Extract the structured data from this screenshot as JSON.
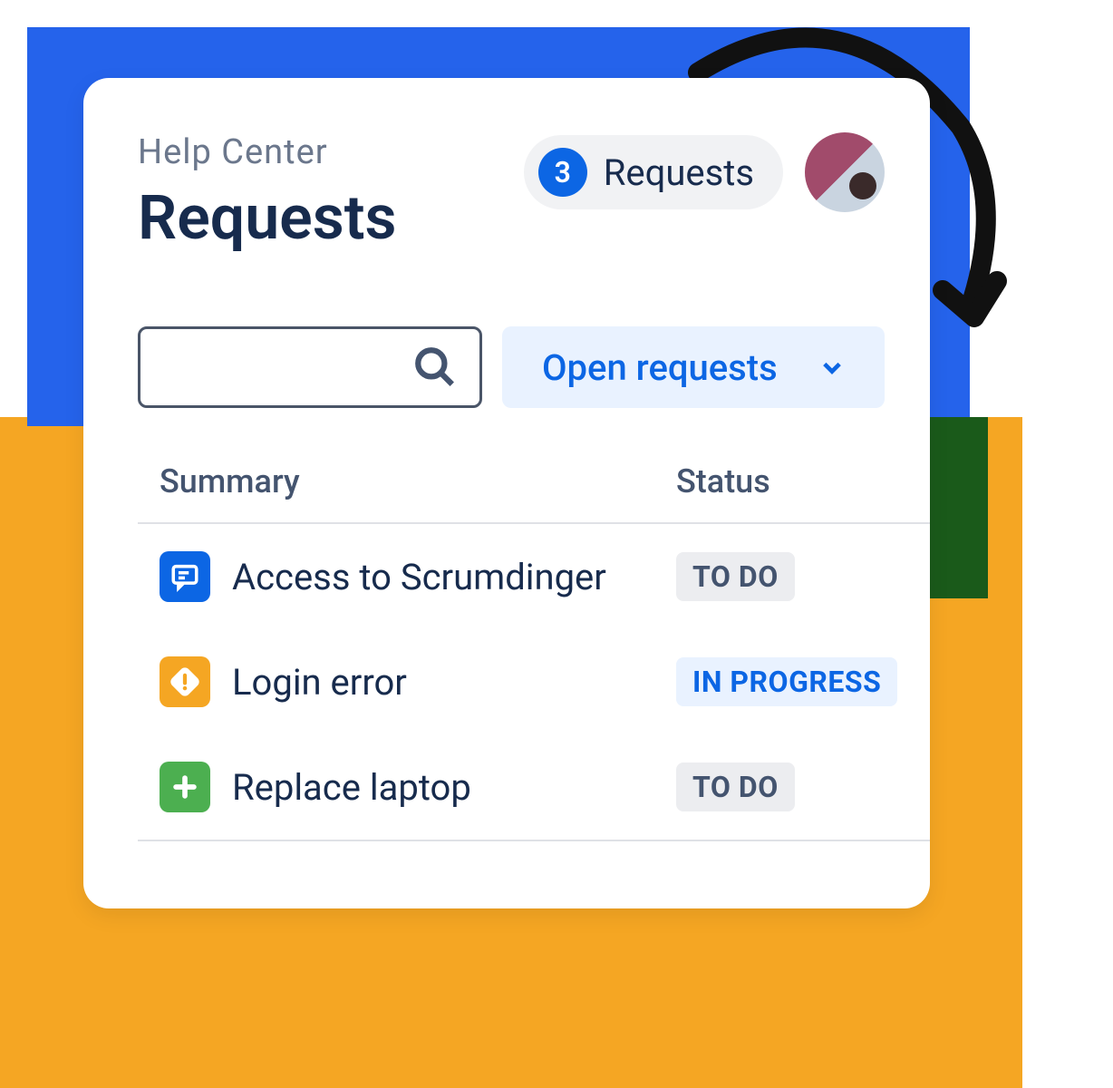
{
  "breadcrumb": "Help Center",
  "page_title": "Requests",
  "header": {
    "badge_count": "3",
    "badge_label": "Requests"
  },
  "filter": {
    "selected": "Open requests"
  },
  "table": {
    "columns": {
      "summary": "Summary",
      "status": "Status"
    },
    "rows": [
      {
        "icon": "chat-icon",
        "icon_color": "blue",
        "summary": "Access to Scrumdinger",
        "status": "TO DO",
        "status_kind": "todo"
      },
      {
        "icon": "alert-icon",
        "icon_color": "orange",
        "summary": "Login error",
        "status": "IN PROGRESS",
        "status_kind": "progress"
      },
      {
        "icon": "plus-icon",
        "icon_color": "green",
        "summary": "Replace laptop",
        "status": "TO DO",
        "status_kind": "todo"
      }
    ]
  }
}
